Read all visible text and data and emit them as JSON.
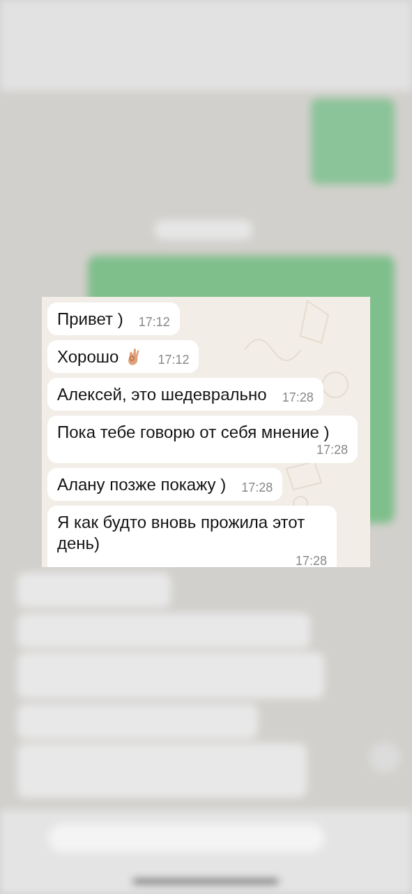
{
  "messages": [
    {
      "kind": "text",
      "text": "Привет )",
      "time": "17:12"
    },
    {
      "kind": "text_ok_hand",
      "text": "Хорошо",
      "time": "17:12"
    },
    {
      "kind": "text",
      "text": "Алексей, это шедеврально",
      "time": "17:28"
    },
    {
      "kind": "text",
      "text": "Пока тебе говорю от себя мнение )",
      "time": "17:28"
    },
    {
      "kind": "text",
      "text": "Алану позже покажу )",
      "time": "17:28"
    },
    {
      "kind": "text",
      "text": "Я как будто вновь прожила этот день)",
      "time": "17:28"
    }
  ]
}
